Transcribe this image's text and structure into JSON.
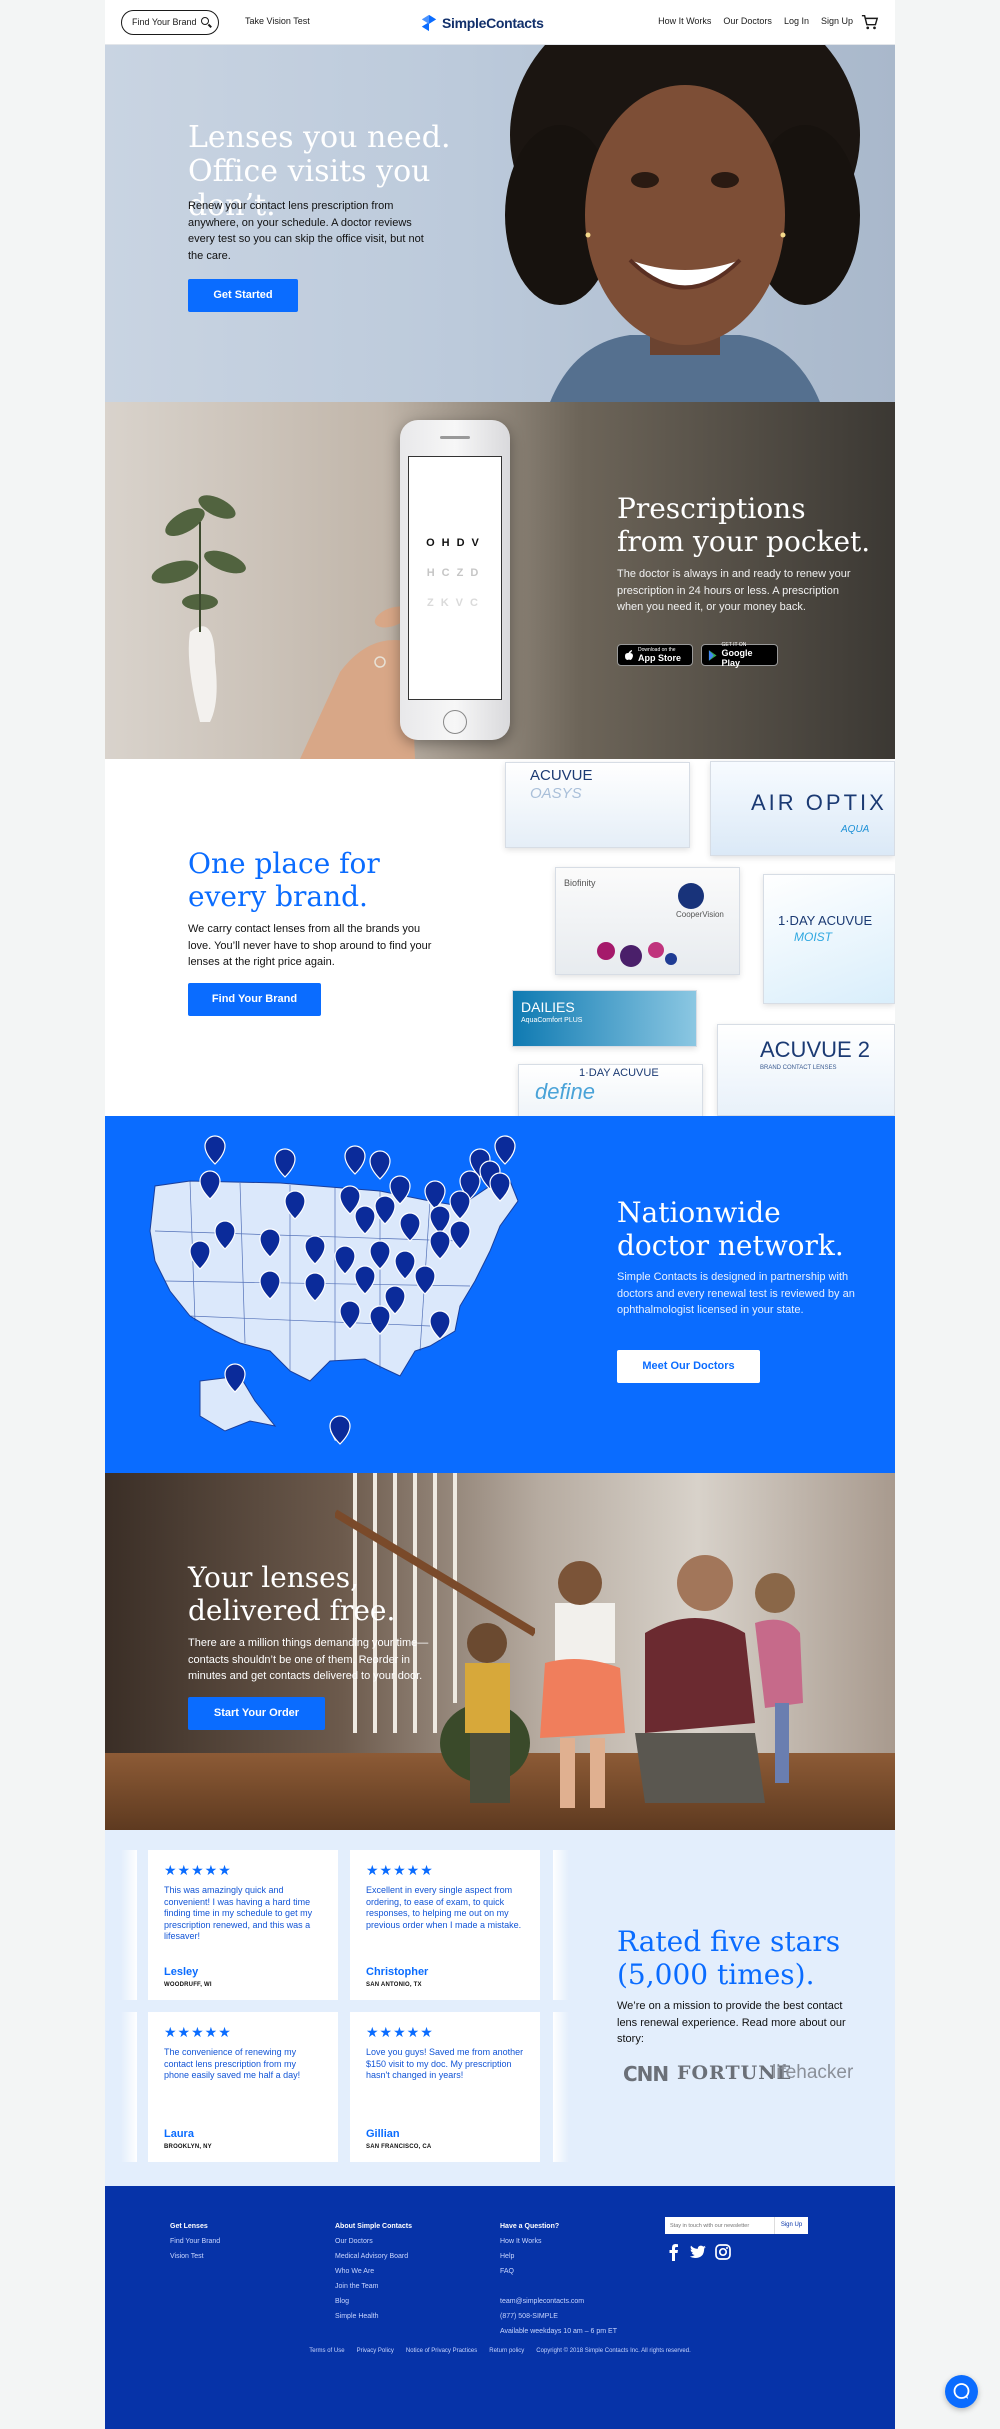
{
  "header": {
    "find_brand": "Find Your Brand",
    "vision_test": "Take Vision Test",
    "logo": "SimpleContacts",
    "nav": [
      "How It Works",
      "Our Doctors",
      "Log In",
      "Sign Up"
    ]
  },
  "hero": {
    "title_line1": "Lenses you need.",
    "title_line2": "Office visits you don’t.",
    "body": "Renew your contact lens prescription from anywhere, on your schedule. A doctor reviews every test so you can skip the office visit, but not the care.",
    "cta": "Get Started"
  },
  "prescriptions": {
    "title_line1": "Prescriptions",
    "title_line2": "from your pocket.",
    "body": "The doctor is always in and ready to renew your prescription in 24 hours or less. A prescription when you need it, or your money back.",
    "eye_chart": [
      "OHDV",
      "HCZD",
      "ZKVC"
    ],
    "app_store_small": "Download on the",
    "app_store": "App Store",
    "play_small": "GET IT ON",
    "play": "Google Play"
  },
  "brands": {
    "title_line1": "One place for",
    "title_line2": "every brand.",
    "body": "We carry contact lenses from all the brands you love. You’ll never have to shop around to find your lenses at the right price again.",
    "cta": "Find Your Brand",
    "boxes": [
      {
        "name": "ACUVUE",
        "sub": "OASYS"
      },
      {
        "name": "AIR OPTIX",
        "sub": "AQUA"
      },
      {
        "name": "Biofinity",
        "sub": "CooperVision"
      },
      {
        "name": "1·DAY ACUVUE",
        "sub": "MOIST"
      },
      {
        "name": "DAILIES",
        "sub": "AquaComfort PLUS"
      },
      {
        "name": "ACUVUE 2",
        "sub": "BRAND CONTACT LENSES"
      },
      {
        "name": "1·DAY ACUVUE",
        "sub": "define"
      }
    ]
  },
  "doctors": {
    "title_line1": "Nationwide",
    "title_line2": "doctor network.",
    "body": "Simple Contacts is designed in partnership with doctors and every renewal test is reviewed by an ophthalmologist licensed in your state.",
    "cta": "Meet Our Doctors"
  },
  "delivered": {
    "title_line1": "Your lenses,",
    "title_line2": "delivered free.",
    "body": "There are a million things demanding your time—contacts shouldn’t be one of them. Reorder in minutes and get contacts delivered to your door.",
    "cta": "Start Your Order"
  },
  "reviews": {
    "stars": "★★★★★",
    "items": [
      {
        "text": "This was amazingly quick and convenient! I was having a hard time finding time in my schedule to get my prescription renewed, and this was a lifesaver!",
        "name": "Lesley",
        "location": "WOODRUFF, WI"
      },
      {
        "text": "Excellent in every single aspect from ordering, to ease of exam, to quick responses, to helping me out on my previous order when I made a mistake.",
        "name": "Christopher",
        "location": "SAN ANTONIO, TX"
      },
      {
        "text": "The convenience of renewing my contact lens prescription from my phone easily saved me half a day!",
        "name": "Laura",
        "location": "BROOKLYN, NY"
      },
      {
        "text": "Love you guys! Saved me from another $150 visit to my doc. My prescription hasn't changed in years!",
        "name": "Gillian",
        "location": "SAN FRANCISCO, CA"
      }
    ],
    "title_line1": "Rated five stars",
    "title_line2": "(5,000 times).",
    "body": "We’re on a mission to provide the best contact lens renewal experience. Read more about our story:",
    "press": [
      "CNN",
      "FORTUNE",
      "lifehacker"
    ]
  },
  "footer": {
    "col1": {
      "heading": "Get Lenses",
      "links": [
        "Find Your Brand",
        "Vision Test"
      ]
    },
    "col2": {
      "heading": "About Simple Contacts",
      "links": [
        "Our Doctors",
        "Medical Advisory Board",
        "Who We Are",
        "Join the Team",
        "Blog",
        "Simple Health"
      ]
    },
    "col3": {
      "heading": "Have a Question?",
      "links": [
        "How It Works",
        "Help",
        "FAQ"
      ]
    },
    "contact": [
      "team@simplecontacts.com",
      "(877) 508-SIMPLE",
      "Available weekdays 10 am – 6 pm ET"
    ],
    "subscribe_placeholder": "Stay in touch with our newsletter",
    "subscribe_button": "Sign Up",
    "legal": [
      "Terms of Use",
      "Privacy Policy",
      "Notice of Privacy Practices",
      "Return policy",
      "Copyright © 2018 Simple Contacts Inc. All rights reserved."
    ]
  },
  "colors": {
    "brand_blue": "#0a6cff",
    "footer_navy": "#0633a8",
    "review_bg": "#e3eefc"
  }
}
